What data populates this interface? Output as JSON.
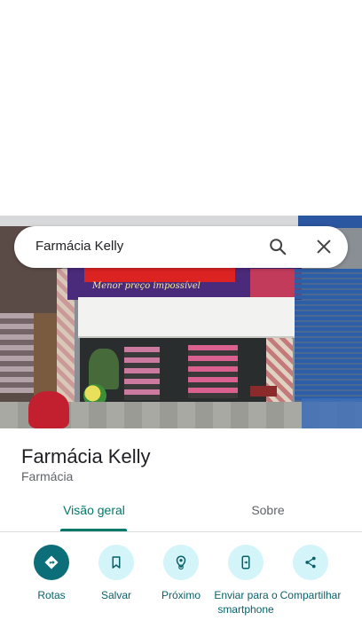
{
  "search": {
    "query": "Farmácia Kelly"
  },
  "photo": {
    "sign_text": "Menor preço impossível"
  },
  "place": {
    "name": "Farmácia Kelly",
    "category": "Farmácia"
  },
  "tabs": [
    {
      "label": "Visão geral",
      "selected": true
    },
    {
      "label": "Sobre",
      "selected": false
    }
  ],
  "actions": [
    {
      "label": "Rotas",
      "icon": "directions-icon"
    },
    {
      "label": "Salvar",
      "icon": "bookmark-icon"
    },
    {
      "label": "Próximo",
      "icon": "nearby-icon"
    },
    {
      "label": "Enviar para o smartphone",
      "icon": "send-to-phone-icon"
    },
    {
      "label": "Compartilhar",
      "icon": "share-icon"
    }
  ],
  "colors": {
    "accent": "#00796b",
    "primary_button": "#0b6e79",
    "chip_bg": "#d3f4f8"
  }
}
